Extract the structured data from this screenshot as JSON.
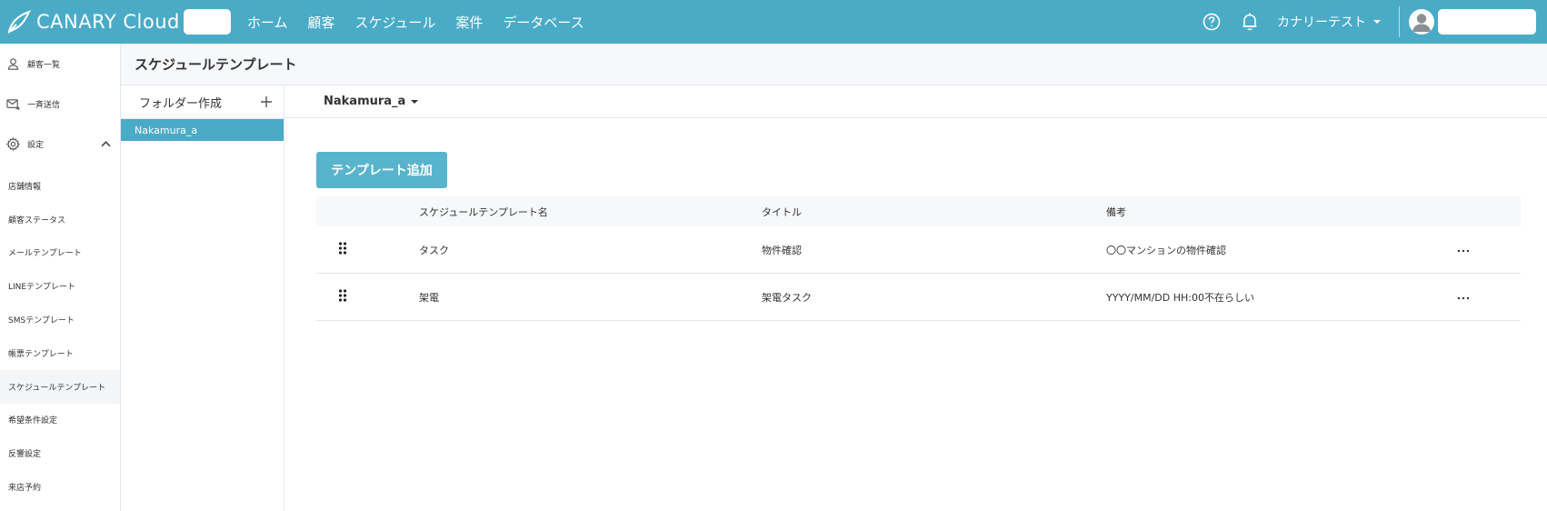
{
  "header": {
    "logo_text": "CANARY Cloud",
    "nav": [
      "ホーム",
      "顧客",
      "スケジュール",
      "案件",
      "データベース"
    ],
    "user_menu_label": "カナリーテスト",
    "bg_color": "#4aabc7"
  },
  "sidebar": {
    "main_items": [
      {
        "label": "顧客一覧",
        "icon": "person-icon"
      },
      {
        "label": "一斉送信",
        "icon": "mail-send-icon"
      },
      {
        "label": "設定",
        "icon": "gear-icon",
        "expanded": true
      }
    ],
    "settings_items": [
      "店舗情報",
      "顧客ステータス",
      "メールテンプレート",
      "LINEテンプレート",
      "SMSテンプレート",
      "帳票テンプレート",
      "スケジュールテンプレート",
      "希望条件設定",
      "反響設定",
      "来店予約"
    ],
    "active_settings_item": "スケジュールテンプレート"
  },
  "page": {
    "title": "スケジュールテンプレート"
  },
  "folders": {
    "create_label": "フォルダー作成",
    "items": [
      "Nakamura_a"
    ],
    "selected": "Nakamura_a"
  },
  "main": {
    "folder_selector": "Nakamura_a",
    "add_button_label": "テンプレート追加",
    "table": {
      "headers": [
        "スケジュールテンプレート名",
        "タイトル",
        "備考"
      ],
      "rows": [
        {
          "name": "タスク",
          "title": "物件確認",
          "note": "〇〇マンションの物件確認"
        },
        {
          "name": "架電",
          "title": "架電タスク",
          "note": "YYYY/MM/DD HH:00不在らしい"
        }
      ]
    }
  }
}
